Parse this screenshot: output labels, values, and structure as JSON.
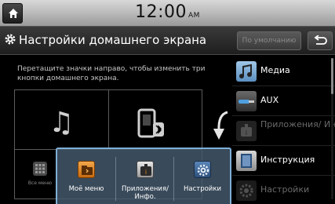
{
  "status": {
    "time": "12:00",
    "ampm": "AM"
  },
  "header": {
    "title": "Настройки домашнего экрана",
    "default_label": "По умолчанию"
  },
  "instruction": "Перетащите значки направо, чтобы изменить три кнопки домашнего экрана.",
  "grid": {
    "all_menu_label": "Все меню"
  },
  "right_list": [
    {
      "label": "Медиа",
      "icon": "media-icon",
      "enabled": true
    },
    {
      "label": "AUX",
      "icon": "aux-icon",
      "enabled": true
    },
    {
      "label": "Приложения/ Инфо.",
      "icon": "apps-info-icon",
      "enabled": false
    },
    {
      "label": "Инструкция",
      "icon": "manual-icon",
      "enabled": true
    },
    {
      "label": "Настройки",
      "icon": "settings-icon",
      "enabled": false
    }
  ],
  "popup": [
    {
      "label": "Моё меню",
      "icon": "my-menu-icon"
    },
    {
      "label": "Приложения/ Инфо.",
      "icon": "apps-info-icon"
    },
    {
      "label": "Настройки",
      "icon": "settings-icon"
    }
  ],
  "colors": {
    "popup_border": "#7fb0d8",
    "accent_orange": "#e08a1e"
  }
}
